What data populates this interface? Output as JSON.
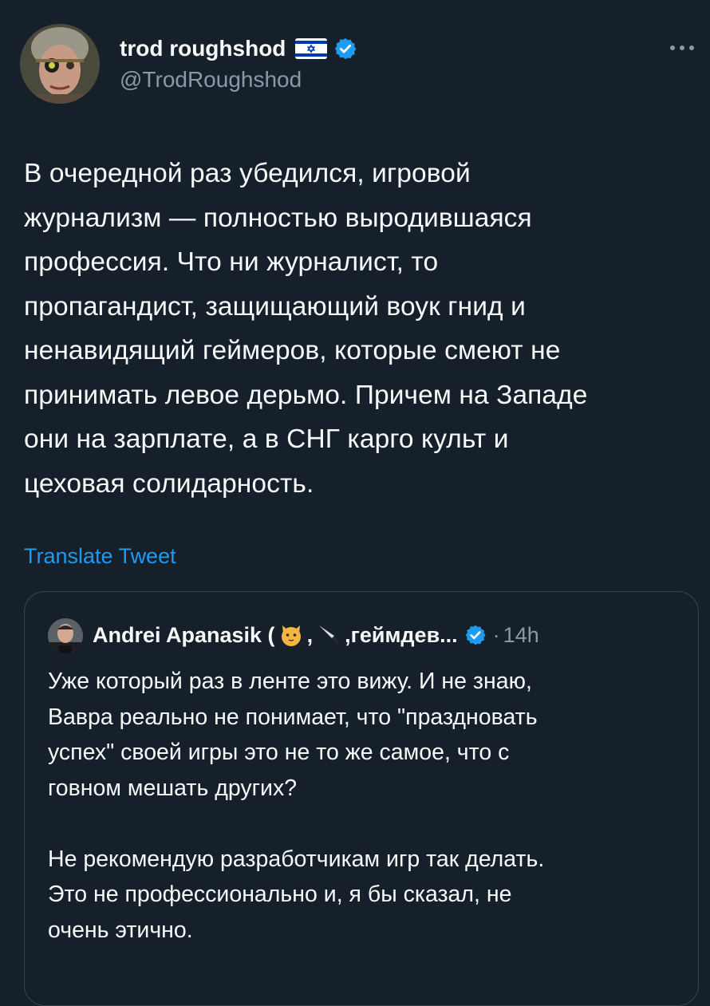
{
  "tweet": {
    "author": {
      "display_name": "trod roughshod",
      "handle": "@TrodRoughshod",
      "flag": "israel-flag",
      "verified_badge": "verified-icon"
    },
    "more_icon": "more-dots-icon",
    "text": "В очередной раз убедился, игровой\nжурнализм — полностью выродившаяся\nпрофессия. Что ни журналист, то\nпропагандист, защищающий воук гнид и\nненавидящий геймеров, которые смеют не\nпринимать левое дерьмо. Причем на Западе\nони на зарплате, а в СНГ карго культ и\nцеховая солидарность.",
    "translate_label": "Translate Tweet"
  },
  "quote": {
    "author": {
      "name_part1": "Andrei Apanasik (",
      "name_sep": ",",
      "name_part2": ",геймдев...",
      "emoji1": "cat-face-icon",
      "emoji2": "knife-icon",
      "verified_badge": "verified-icon"
    },
    "dot": "·",
    "time": "14h",
    "text": "Уже который раз в ленте это вижу. И не знаю,\nВавра реально не понимает, что \"праздновать\nуспех\" своей игры это не то же самое, что с\nговном мешать других?\n\nНе рекомендую разработчикам игр так делать.\nЭто не профессионально и, я бы сказал, не\nочень этично."
  },
  "colors": {
    "background": "#15202b",
    "text_primary": "#f7f9f9",
    "text_secondary": "#8b98a5",
    "accent": "#1d9bf0",
    "border": "#38444d"
  }
}
